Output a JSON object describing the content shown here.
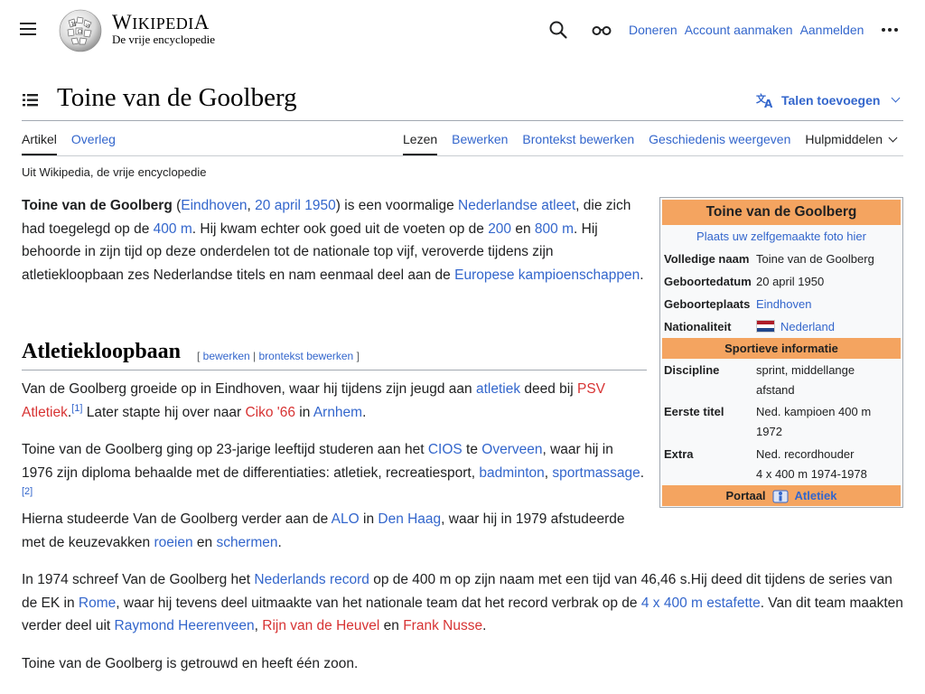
{
  "header": {
    "wordmark_w": "W",
    "wordmark_rest": "IKIPEDI",
    "wordmark_a": "A",
    "tagline": "De vrije encyclopedie",
    "links": [
      "Doneren",
      "Account aanmaken",
      "Aanmelden"
    ]
  },
  "page": {
    "title": "Toine van de Goolberg",
    "languages_button": "Talen toevoegen",
    "from_wiki": "Uit Wikipedia, de vrije encyclopedie"
  },
  "tabs": {
    "left": [
      "Artikel",
      "Overleg"
    ],
    "right": [
      "Lezen",
      "Bewerken",
      "Brontekst bewerken",
      "Geschiedenis weergeven",
      "Hulpmiddelen"
    ]
  },
  "article": {
    "p1": {
      "name": "Toine van de Goolberg",
      "t1": " (",
      "l1": "Eindhoven",
      "t2": ", ",
      "l2": "20 april 1950",
      "t3": ") is een voormalige ",
      "l3": "Nederlandse atleet",
      "t4": ", die zich had toegelegd op de ",
      "l4": "400 m",
      "t5": ". Hij kwam echter ook goed uit de voeten op de ",
      "l5": "200",
      "t6": " en ",
      "l6": "800 m",
      "t7": ". Hij behoorde in zijn tijd op deze onderdelen tot de nationale top vijf, veroverde tijdens zijn atletiekloopbaan zes Nederlandse titels en nam eenmaal deel aan de ",
      "l7": "Europese kampioenschappen",
      "t8": "."
    },
    "section_title": "Atletiekloopbaan",
    "edit_open": "[ ",
    "edit_1": "bewerken",
    "edit_sep": " | ",
    "edit_2": "brontekst bewerken",
    "edit_close": " ]",
    "p2": {
      "t1": "Van de Goolberg groeide op in Eindhoven, waar hij tijdens zijn jeugd aan ",
      "l1": "atletiek",
      "t2": " deed bij ",
      "r1": "PSV Atletiek",
      "t3": ".",
      "ref": "[1]",
      "t4": " Later stapte hij over naar ",
      "r2": "Ciko '66",
      "t5": " in ",
      "l2": "Arnhem",
      "t6": "."
    },
    "p3": {
      "t1": "Toine van de Goolberg ging op 23-jarige leeftijd studeren aan het ",
      "l1": "CIOS",
      "t2": " te ",
      "l2": "Overveen",
      "t3": ", waar hij in 1976 zijn diploma behaalde met de differentiaties: atletiek, recreatiesport, ",
      "l3": "badminton",
      "t4": ", ",
      "l4": "sportmassage",
      "t5": ".",
      "ref": "[2]",
      "t6": "Hierna studeerde Van de Goolberg verder aan de ",
      "l5": "ALO",
      "t7": " in ",
      "l6": "Den Haag",
      "t8": ", waar hij in 1979 afstudeerde met de keuzevakken ",
      "l7": "roeien",
      "t9": " en ",
      "l8": "schermen",
      "t10": "."
    },
    "p4": {
      "t1": "In 1974 schreef Van de Goolberg het ",
      "l1": "Nederlands record",
      "t2": " op de 400 m op zijn naam met een tijd van 46,46 s.Hij deed dit tijdens de series van de EK in ",
      "l2": "Rome",
      "t3": ", waar hij tevens deel uitmaakte van het nationale team dat het record verbrak op de ",
      "l3": "4 x 400 m estafette",
      "t4": ". Van dit team maakten verder deel uit ",
      "l4": "Raymond Heerenveen",
      "t5": ", ",
      "r1": "Rijn van de Heuvel",
      "t6": " en ",
      "r2": "Frank Nusse",
      "t7": "."
    },
    "p5": "Toine van de Goolberg is getrouwd en heeft één zoon."
  },
  "infobox": {
    "title": "Toine van de Goolberg",
    "photo_link": "Plaats uw zelfgemaakte foto hier",
    "rows": [
      {
        "label": "Volledige naam",
        "value": "Toine van de Goolberg"
      },
      {
        "label": "Geboortedatum",
        "value": "20 april 1950"
      },
      {
        "label": "Geboorteplaats",
        "value": "Eindhoven"
      },
      {
        "label": "Nationaliteit",
        "value": "Nederland"
      }
    ],
    "section": "Sportieve informatie",
    "sport_rows": [
      {
        "label": "Discipline",
        "value1": "sprint, middellange",
        "value2": "afstand"
      },
      {
        "label": "Eerste titel",
        "value1": "Ned. kampioen 400 m",
        "value2": "1972"
      },
      {
        "label": "Extra",
        "value1": "Ned. recordhouder",
        "value2": "4 x 400 m 1974-1978"
      }
    ],
    "portal_label": "Portaal",
    "portal_link": "Atletiek",
    "flag_colors": [
      "#ae1c28",
      "#ffffff",
      "#21468b"
    ],
    "header_color": "#f4a460"
  }
}
